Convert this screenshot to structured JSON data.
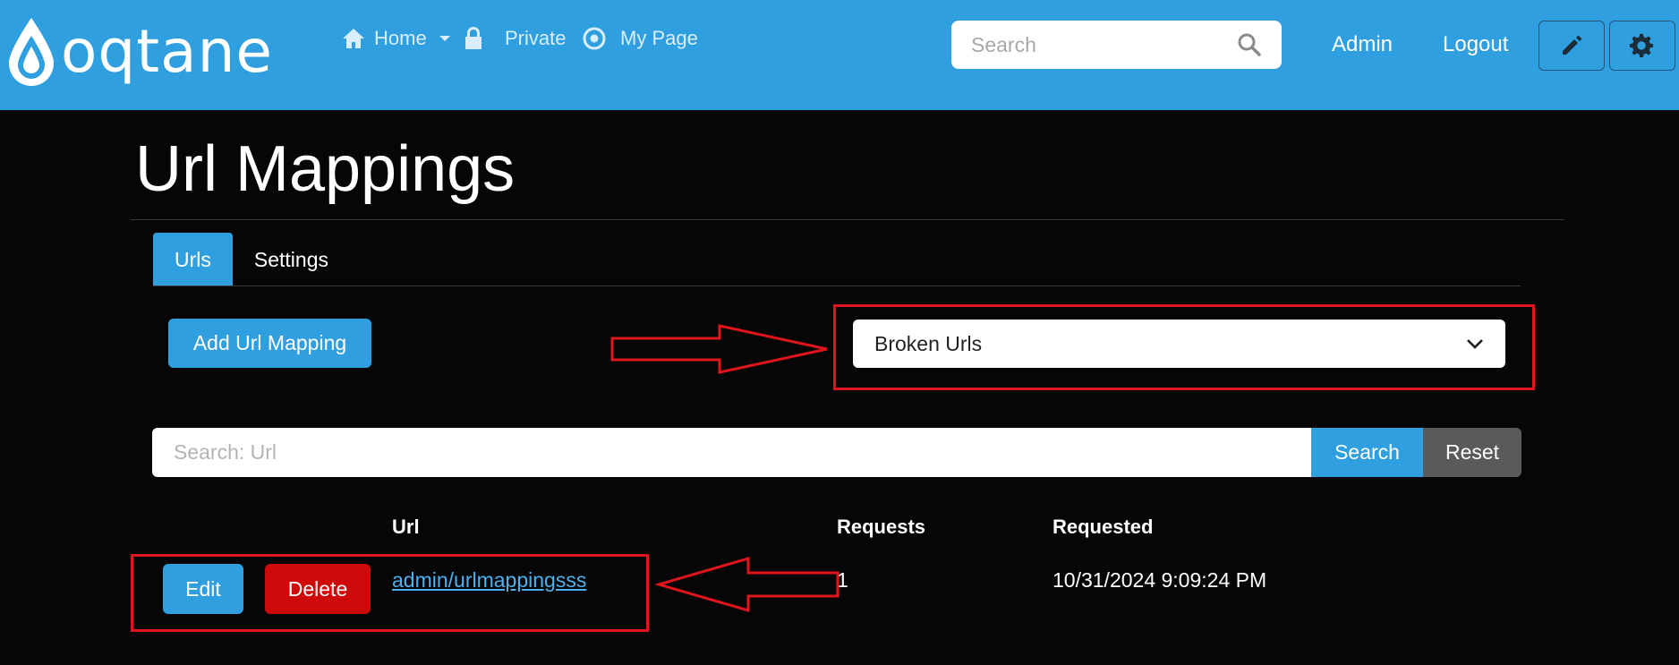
{
  "header": {
    "logo_text": "oqtane",
    "nav": [
      {
        "label": "Home",
        "icon": "home-icon",
        "has_dropdown": true
      },
      {
        "label": "Private",
        "icon": "lock-icon"
      },
      {
        "label": "My Page",
        "icon": "target-icon"
      }
    ],
    "search_placeholder": "Search",
    "user_label": "Admin",
    "logout_label": "Logout",
    "edit_icon": "pencil-icon",
    "settings_icon": "gear-icon"
  },
  "page": {
    "title": "Url Mappings",
    "tabs": [
      {
        "label": "Urls",
        "active": true
      },
      {
        "label": "Settings",
        "active": false
      }
    ],
    "add_button_label": "Add Url Mapping",
    "filter_selected": "Broken Urls",
    "search_placeholder": "Search: Url",
    "search_button_label": "Search",
    "reset_button_label": "Reset"
  },
  "table": {
    "columns": [
      "Url",
      "Requests",
      "Requested"
    ],
    "rows": [
      {
        "edit_label": "Edit",
        "delete_label": "Delete",
        "url": "admin/urlmappingsss",
        "requests": "1",
        "requested": "10/31/2024 9:09:24 PM"
      }
    ]
  },
  "colors": {
    "brand": "#2f9fe0",
    "background": "#060606",
    "danger": "#cf0a0a",
    "annotation": "#e0141c"
  }
}
